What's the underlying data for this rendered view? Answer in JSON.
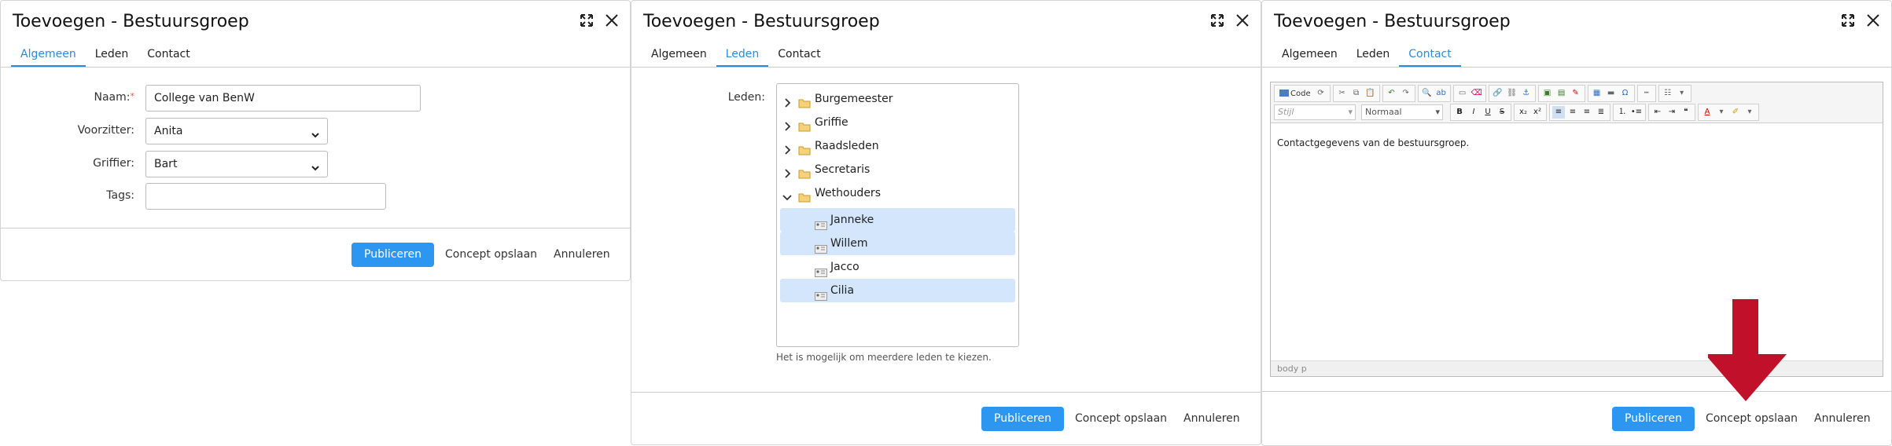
{
  "dialog1": {
    "title": "Toevoegen - Bestuursgroep",
    "tabs": [
      "Algemeen",
      "Leden",
      "Contact"
    ],
    "active_tab": "Algemeen",
    "fields": {
      "naam_label": "Naam:",
      "naam_required": "*",
      "naam_value": "College van BenW",
      "voorzitter_label": "Voorzitter:",
      "voorzitter_value": "Anita",
      "griffier_label": "Griffier:",
      "griffier_value": "Bart",
      "tags_label": "Tags:",
      "tags_value": ""
    },
    "footer": {
      "publish": "Publiceren",
      "draft": "Concept opslaan",
      "cancel": "Annuleren"
    }
  },
  "dialog2": {
    "title": "Toevoegen - Bestuursgroep",
    "tabs": [
      "Algemeen",
      "Leden",
      "Contact"
    ],
    "active_tab": "Leden",
    "leden_label": "Leden:",
    "tree": [
      {
        "label": "Burgemeester",
        "type": "folder",
        "expanded": false
      },
      {
        "label": "Griffie",
        "type": "folder",
        "expanded": false
      },
      {
        "label": "Raadsleden",
        "type": "folder",
        "expanded": false
      },
      {
        "label": "Secretaris",
        "type": "folder",
        "expanded": false
      },
      {
        "label": "Wethouders",
        "type": "folder",
        "expanded": true
      },
      {
        "label": "Janneke",
        "type": "person",
        "selected": true
      },
      {
        "label": "Willem",
        "type": "person",
        "selected": true
      },
      {
        "label": "Jacco",
        "type": "person",
        "selected": false
      },
      {
        "label": "Cilia",
        "type": "person",
        "selected": true
      }
    ],
    "hint": "Het is mogelijk om meerdere leden te kiezen.",
    "footer": {
      "publish": "Publiceren",
      "draft": "Concept opslaan",
      "cancel": "Annuleren"
    }
  },
  "dialog3": {
    "title": "Toevoegen - Bestuursgroep",
    "tabs": [
      "Algemeen",
      "Leden",
      "Contact"
    ],
    "active_tab": "Contact",
    "editor": {
      "code_label": "Code",
      "style_placeholder": "Stijl",
      "format_value": "Normaal",
      "content": "Contactgegevens van de bestuursgroep.",
      "status_path": "body  p"
    },
    "footer": {
      "publish": "Publiceren",
      "draft": "Concept opslaan",
      "cancel": "Annuleren"
    }
  },
  "colors": {
    "accent": "#2d96f0",
    "tab_active": "#2b8ad9",
    "selection": "#d3e6fb",
    "arrow": "#c0102a",
    "folder": "#e8b64a"
  }
}
